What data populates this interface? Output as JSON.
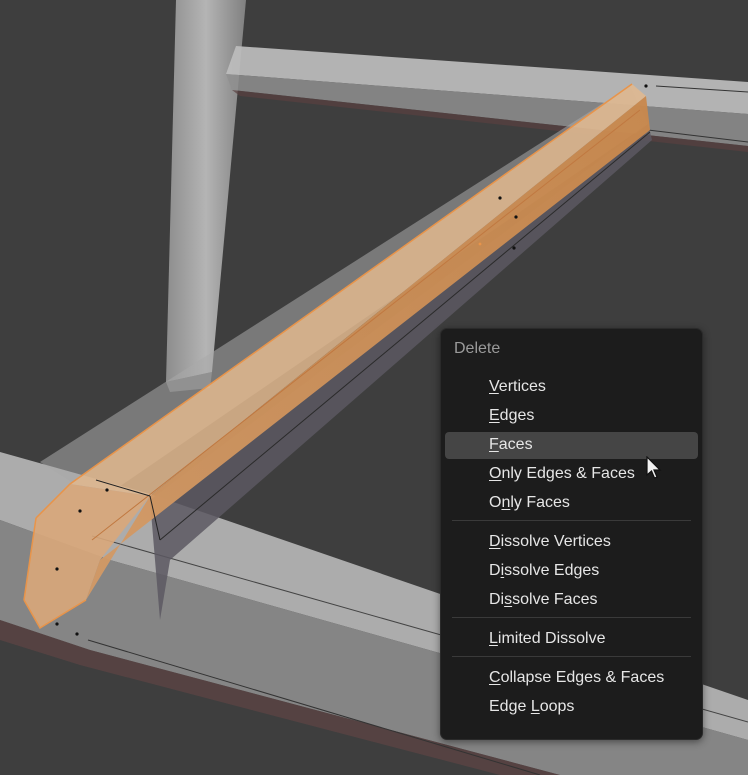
{
  "colors": {
    "background": "#3e3e3e",
    "menu_background": "#1c1c1c",
    "menu_highlight": "#454545",
    "selection_orange": "#e8944a"
  },
  "menu": {
    "title": "Delete",
    "groups": [
      [
        {
          "pre": "",
          "ul": "V",
          "post": "ertices"
        },
        {
          "pre": "",
          "ul": "E",
          "post": "dges"
        },
        {
          "pre": "",
          "ul": "F",
          "post": "aces",
          "active": true
        },
        {
          "pre": "",
          "ul": "O",
          "post": "nly Edges & Faces"
        },
        {
          "pre": "O",
          "ul": "n",
          "post": "ly Faces"
        }
      ],
      [
        {
          "pre": "",
          "ul": "D",
          "post": "issolve Vertices"
        },
        {
          "pre": "D",
          "ul": "i",
          "post": "ssolve Edges"
        },
        {
          "pre": "Di",
          "ul": "s",
          "post": "solve Faces"
        }
      ],
      [
        {
          "pre": "",
          "ul": "L",
          "post": "imited Dissolve"
        }
      ],
      [
        {
          "pre": "",
          "ul": "C",
          "post": "ollapse Edges & Faces"
        },
        {
          "pre": "Edge ",
          "ul": "L",
          "post": "oops"
        }
      ]
    ]
  },
  "cursor": {
    "icon": "mouse-pointer-icon"
  }
}
